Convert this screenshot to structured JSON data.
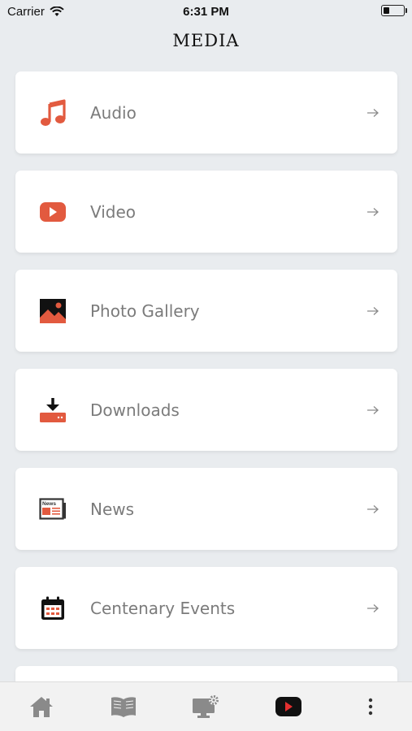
{
  "status_bar": {
    "carrier": "Carrier",
    "time": "6:31 PM",
    "battery_level": 0.25
  },
  "header": {
    "title": "MEDIA"
  },
  "menu": {
    "items": [
      {
        "label": "Audio",
        "icon": "music-note-icon"
      },
      {
        "label": "Video",
        "icon": "play-video-icon"
      },
      {
        "label": "Photo Gallery",
        "icon": "photo-icon"
      },
      {
        "label": "Downloads",
        "icon": "download-icon"
      },
      {
        "label": "News",
        "icon": "newspaper-icon"
      },
      {
        "label": "Centenary Events",
        "icon": "calendar-icon"
      }
    ],
    "news_icon_text": "News"
  },
  "bottom_nav": {
    "items": [
      {
        "icon": "home-icon",
        "active": false
      },
      {
        "icon": "book-icon",
        "active": false
      },
      {
        "icon": "monitor-settings-icon",
        "active": false
      },
      {
        "icon": "play-video-icon",
        "active": true
      },
      {
        "icon": "more-vertical-icon",
        "active": false
      }
    ]
  },
  "colors": {
    "accent": "#e25a3f",
    "background": "#e9ecef",
    "label": "#7b7b7b",
    "nav_icon": "#8a8a8a"
  }
}
